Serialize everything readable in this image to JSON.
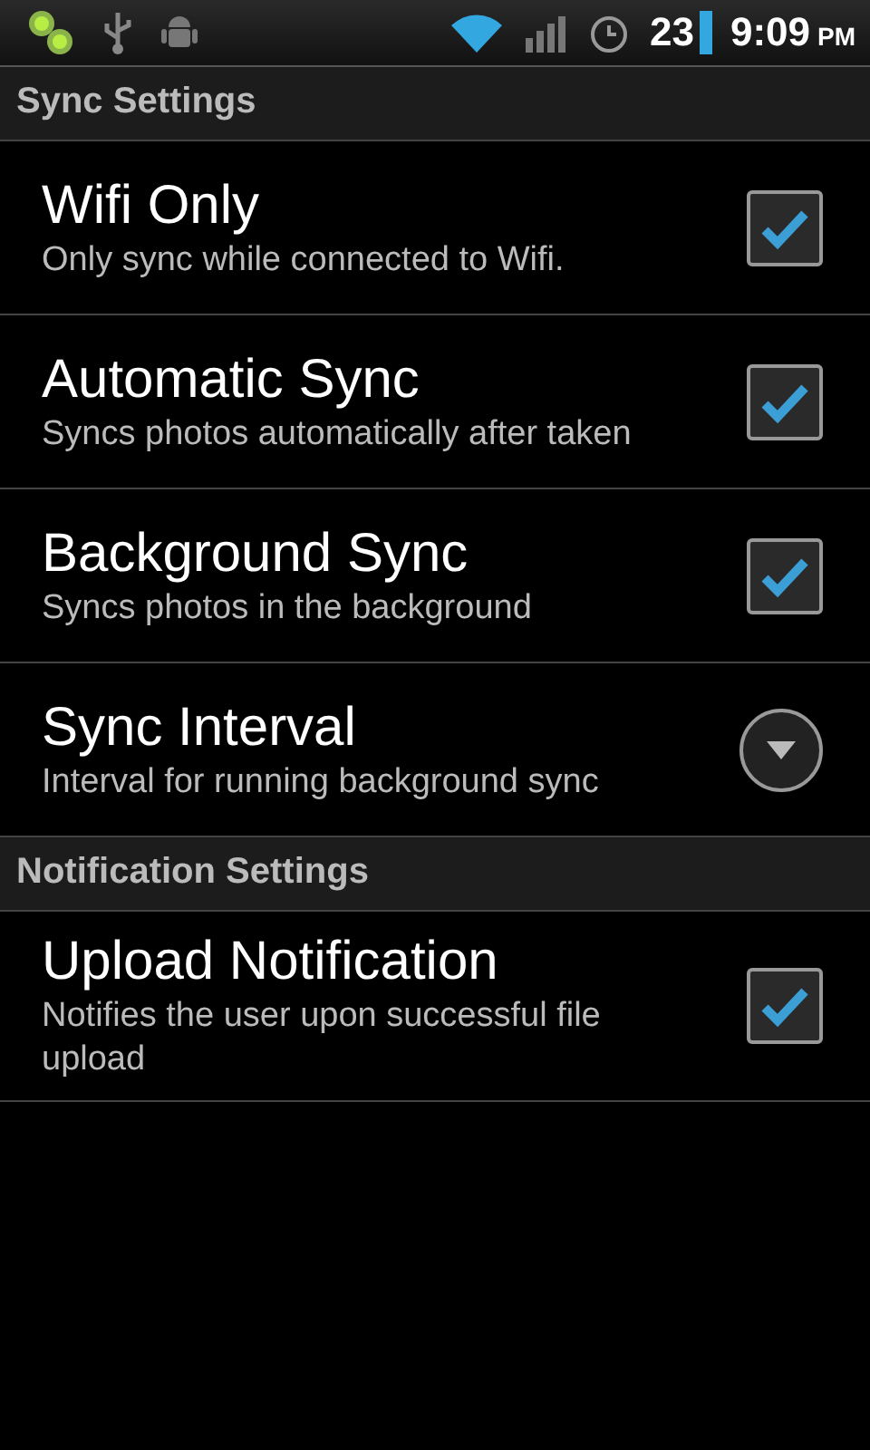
{
  "status_bar": {
    "battery": "23",
    "time": "9:09",
    "ampm": "PM"
  },
  "sections": [
    {
      "title": "Sync Settings",
      "items": [
        {
          "kind": "checkbox",
          "title": "Wifi Only",
          "summary": "Only sync while connected to Wifi.",
          "checked": true
        },
        {
          "kind": "checkbox",
          "title": "Automatic Sync",
          "summary": "Syncs photos automatically after taken",
          "checked": true
        },
        {
          "kind": "checkbox",
          "title": "Background Sync",
          "summary": "Syncs photos in the background",
          "checked": true
        },
        {
          "kind": "dropdown",
          "title": "Sync Interval",
          "summary": "Interval for running background sync"
        }
      ]
    },
    {
      "title": "Notification Settings",
      "items": [
        {
          "kind": "checkbox",
          "title": "Upload Notification",
          "summary": "Notifies the user upon successful file upload",
          "checked": true
        }
      ]
    }
  ]
}
